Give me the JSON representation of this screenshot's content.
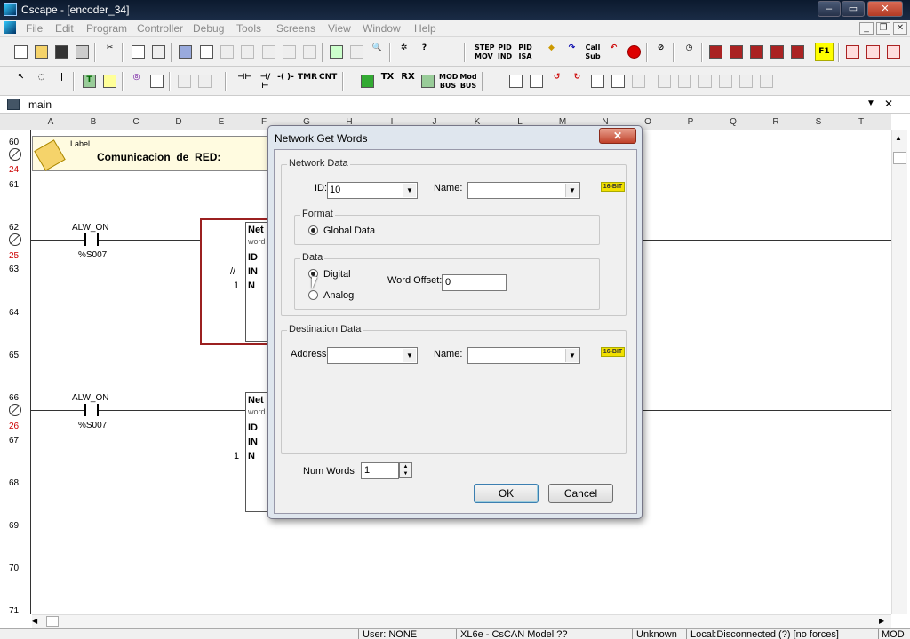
{
  "window": {
    "title": "Cscape - [encoder_34]"
  },
  "window_controls": {
    "minimize": "–",
    "maximize": "▭",
    "close": "✕"
  },
  "menu": [
    "File",
    "Edit",
    "Program",
    "Controller",
    "Debug",
    "Tools",
    "Screens",
    "View",
    "Window",
    "Help"
  ],
  "mdi_controls": {
    "minimize": "_",
    "restore": "❐",
    "close": "✕"
  },
  "toolbar1_text": {
    "step_mov": "STEP\nMOV",
    "pid_ind": "PID\nIND",
    "pid_isa": "PID\nISA",
    "call_sub": "Call\nSub",
    "f1": "F1"
  },
  "toolbar2_text": {
    "tmr": "TMR",
    "cnt": "CNT",
    "tx": "TX",
    "rx": "RX",
    "mod_bus1": "MOD\nBUS",
    "mod_bus2": "Mod\nBUS"
  },
  "tab": {
    "label": "main",
    "dropdown": "▼",
    "close": "✕"
  },
  "columns": [
    "A",
    "B",
    "C",
    "D",
    "E",
    "F",
    "G",
    "H",
    "I",
    "J",
    "K",
    "L",
    "M",
    "N",
    "O",
    "P",
    "Q",
    "R",
    "S",
    "T"
  ],
  "rows": [
    {
      "n": "60"
    },
    {
      "n": "24",
      "red": true
    },
    {
      "n": "61"
    },
    {
      "n": "62"
    },
    {
      "n": "25",
      "red": true
    },
    {
      "n": "63"
    },
    {
      "n": "64"
    },
    {
      "n": "65"
    },
    {
      "n": "66"
    },
    {
      "n": "26",
      "red": true
    },
    {
      "n": "67"
    },
    {
      "n": "68"
    },
    {
      "n": "69"
    },
    {
      "n": "70"
    },
    {
      "n": "71"
    }
  ],
  "ladder": {
    "label_tag": "Label",
    "label_text": "Comunicacion_de_RED:",
    "contact1": {
      "name": "ALW_ON",
      "address": "%S007"
    },
    "contact2": {
      "name": "ALW_ON",
      "address": "%S007"
    },
    "block_title": "Net",
    "block_sub": "word",
    "pins": [
      "ID",
      "IN",
      "N"
    ],
    "in_wire": "//",
    "n_value": "1"
  },
  "dialog": {
    "title": "Network Get Words",
    "close": "✕",
    "network_data": {
      "group_label": "Network Data",
      "id_label": "ID:",
      "id_value": "10",
      "name_label": "Name:",
      "name_value": "",
      "bit_tag": "16-BIT"
    },
    "format": {
      "group_label": "Format",
      "option": "Global Data",
      "selected": true
    },
    "data": {
      "group_label": "Data",
      "options": [
        "Digital",
        "Analog"
      ],
      "selected": "Digital",
      "word_offset_label": "Word Offset:",
      "word_offset_value": "0"
    },
    "destination_data": {
      "group_label": "Destination Data",
      "address_label": "Address:",
      "address_value": "",
      "name_label": "Name:",
      "name_value": "",
      "bit_tag": "16-BIT"
    },
    "num_words": {
      "label": "Num Words",
      "value": "1"
    },
    "buttons": {
      "ok": "OK",
      "cancel": "Cancel"
    }
  },
  "status_bar": [
    "User: NONE",
    "XL6e - CsCAN Model ??",
    "Unknown",
    "Local:Disconnected (?) [no forces]",
    "MOD"
  ]
}
